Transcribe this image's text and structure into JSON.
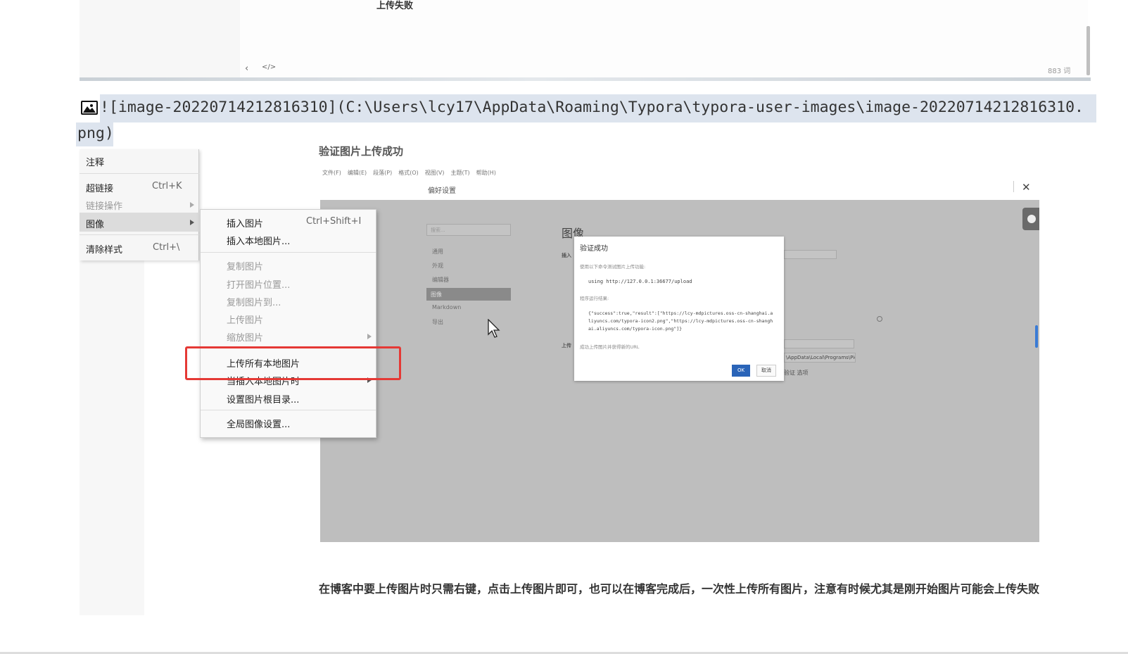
{
  "top_preview": {
    "title": "上传失败",
    "nav_back": "‹",
    "nav_code": "</>",
    "word_count": "883 词"
  },
  "markdown_line": {
    "icon": "image-icon",
    "text_line1": "![image-20220714212816310](C:\\Users\\lcy17\\AppData\\Roaming\\Typora\\typora-user-images\\image-20220714212816310.",
    "text_line2": "png)"
  },
  "embedded_screenshot": {
    "heading": "验证图片上传成功",
    "menubar": [
      "文件(F)",
      "编辑(E)",
      "段落(P)",
      "格式(O)",
      "视图(V)",
      "主题(T)",
      "帮助(H)"
    ],
    "preferences_title": "偏好设置",
    "close_icon": "close-icon",
    "search_placeholder": "搜索...",
    "nav_items": [
      "通用",
      "外观",
      "编辑器",
      "图像",
      "Markdown",
      "导出"
    ],
    "section_title": "图像",
    "insert_label": "插入",
    "upload_label": "上传",
    "path_value": "\\AppData\\Local\\Programs\\Pic",
    "buttons_text": "验证   选项",
    "dialog": {
      "title": "验证成功",
      "subtitle": "使用以下命令测试图片上传功能:",
      "command": "using http://127.0.0.1:36677/upload",
      "result_label": "程序运行结果:",
      "result_json": "{\"success\":true,\"result\":[\"https://lcy-mdpictures.oss-cn-shanghai.aliyuncs.com/typora-icon2.png\",\"https://lcy-mdpictures.oss-cn-shanghai.aliyuncs.com/typora-icon.png\"]}",
      "note": "成功上传图片并获得新的URL",
      "ok_label": "OK",
      "cancel_label": "取消"
    }
  },
  "context_menu": {
    "items": [
      {
        "label": "注释",
        "shortcut": ""
      },
      {
        "label": "超链接",
        "shortcut": "Ctrl+K"
      },
      {
        "label": "链接操作",
        "shortcut": ""
      },
      {
        "label": "图像",
        "shortcut": ""
      },
      {
        "label": "清除样式",
        "shortcut": "Ctrl+\\"
      }
    ]
  },
  "image_submenu": {
    "items": [
      {
        "label": "插入图片",
        "shortcut": "Ctrl+Shift+I"
      },
      {
        "label": "插入本地图片..."
      },
      {
        "label": "复制图片"
      },
      {
        "label": "打开图片位置..."
      },
      {
        "label": "复制图片到..."
      },
      {
        "label": "上传图片"
      },
      {
        "label": "缩放图片"
      },
      {
        "label": "上传所有本地图片"
      },
      {
        "label": "当插入本地图片时"
      },
      {
        "label": "设置图片根目录..."
      },
      {
        "label": "全局图像设置..."
      }
    ]
  },
  "bottom_paragraph": "在博客中要上传图片时只需右键，点击上传图片即可，也可以在博客完成后，一次性上传所有图片，注意有时候尤其是刚开始图片可能会上传失败",
  "colors": {
    "highlight": "#dde4ee",
    "red_box": "#e53935",
    "ok_button": "#2a64b8"
  }
}
